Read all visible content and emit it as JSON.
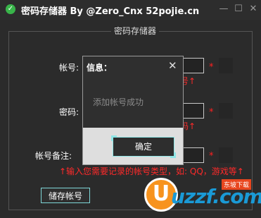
{
  "window": {
    "title": "密码存储器 By @Zero_Cnx 52pojie.cn",
    "min_glyph": "—",
    "max_glyph": "☐",
    "close_glyph": "✕"
  },
  "group": {
    "title": "密码存储器"
  },
  "form": {
    "account_label": "帐号:",
    "password_label": "密码:",
    "note_label": "帐号备注:",
    "required_mark": "*",
    "account_hint": "号↑",
    "password_hint": "码↑",
    "note_hint": "↑输入您需要记录的帐号类型，如: QQ，游戏等↑",
    "save_button": "储存帐号"
  },
  "dialog": {
    "title": "信息：",
    "close_glyph": "✕",
    "message": "添加帐号成功",
    "ok_button": "确定"
  },
  "watermark": {
    "brand": "uzzf.com",
    "badge": "东坡下载",
    "logo_letter": "U"
  },
  "colors": {
    "background": "#2b2b2b",
    "accent_cyan": "#8fe6e6",
    "warning_red": "#ff2a2a",
    "success_green": "#39b54a"
  },
  "icons": {
    "app": "check-circle-icon",
    "dialog_close": "close-icon"
  }
}
